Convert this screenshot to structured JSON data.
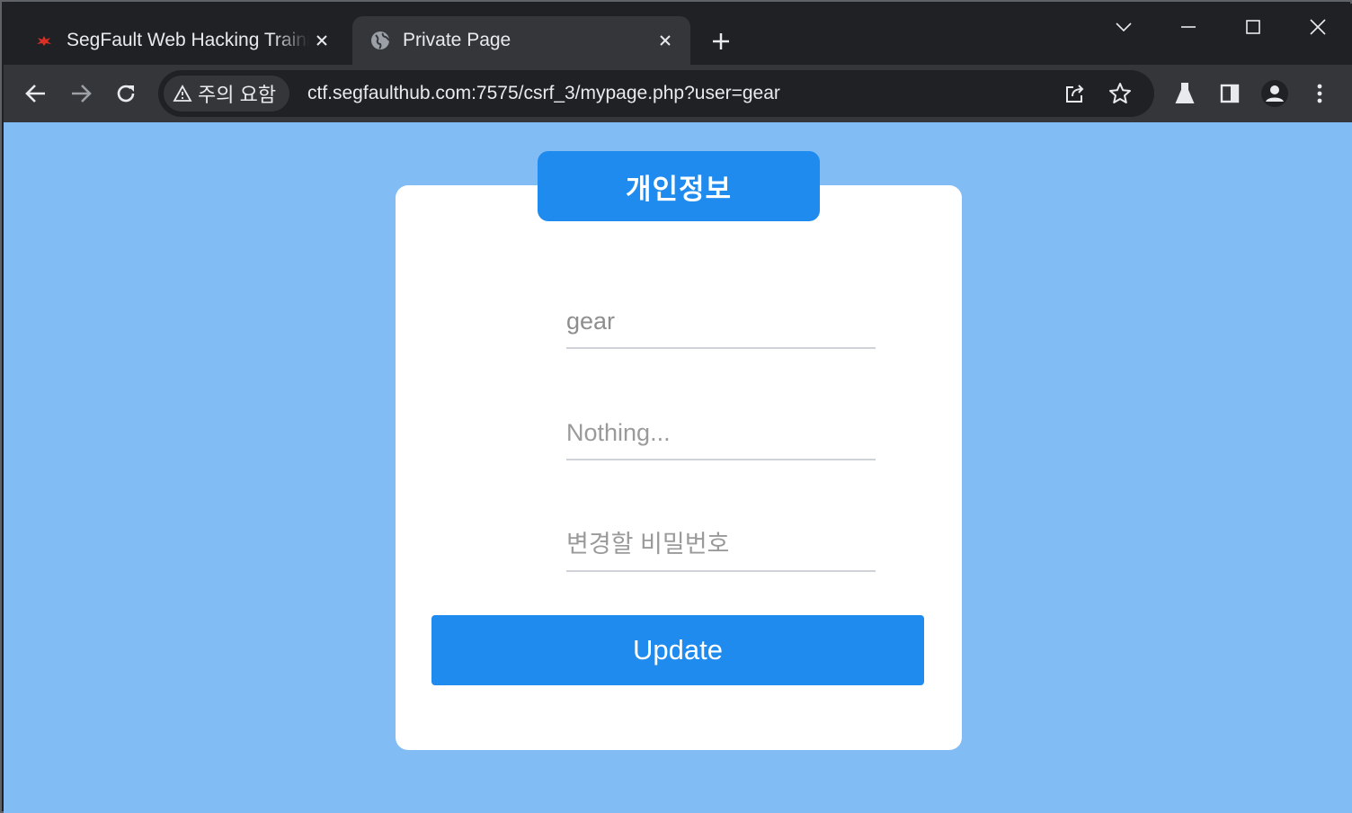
{
  "browser": {
    "tabs": [
      {
        "title": "SegFault Web Hacking Training",
        "favicon": "segfault-bug-icon",
        "active": false
      },
      {
        "title": "Private Page",
        "favicon": "globe-icon",
        "active": true
      }
    ],
    "new_tab_label": "+",
    "address_bar": {
      "security_label": "주의 요함",
      "url": "ctf.segfaulthub.com:7575/csrf_3/mypage.php?user=gear"
    },
    "icons": {
      "back": "back-arrow-icon",
      "forward": "forward-arrow-icon",
      "reload": "reload-icon",
      "share": "share-icon",
      "bookmark": "star-icon",
      "labs": "flask-icon",
      "side_panel": "side-panel-icon",
      "profile": "profile-icon",
      "menu": "kebab-menu-icon"
    }
  },
  "page": {
    "header": "개인정보",
    "fields": {
      "username_placeholder": "gear",
      "info_placeholder": "Nothing...",
      "password_placeholder": "변경할 비밀번호"
    },
    "update_label": "Update"
  },
  "colors": {
    "background": "#82bcf4",
    "accent": "#1f8bee",
    "card": "#ffffff"
  }
}
